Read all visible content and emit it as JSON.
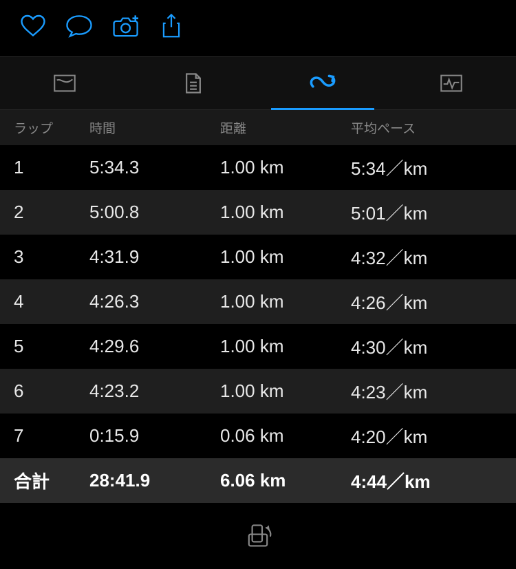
{
  "colors": {
    "accent": "#1a9cff"
  },
  "toolbar": {
    "icons": [
      "heart-icon",
      "comment-icon",
      "camera-plus-icon",
      "share-icon"
    ]
  },
  "tabs": {
    "items": [
      "route-tab",
      "notes-tab",
      "laps-tab",
      "heart-tab"
    ],
    "activeIndex": 2
  },
  "table": {
    "headers": {
      "lap": "ラップ",
      "time": "時間",
      "distance": "距離",
      "pace": "平均ペース"
    },
    "rows": [
      {
        "lap": "1",
        "time": "5:34.3",
        "distance": "1.00 km",
        "pace": "5:34／km"
      },
      {
        "lap": "2",
        "time": "5:00.8",
        "distance": "1.00 km",
        "pace": "5:01／km"
      },
      {
        "lap": "3",
        "time": "4:31.9",
        "distance": "1.00 km",
        "pace": "4:32／km"
      },
      {
        "lap": "4",
        "time": "4:26.3",
        "distance": "1.00 km",
        "pace": "4:26／km"
      },
      {
        "lap": "5",
        "time": "4:29.6",
        "distance": "1.00 km",
        "pace": "4:30／km"
      },
      {
        "lap": "6",
        "time": "4:23.2",
        "distance": "1.00 km",
        "pace": "4:23／km"
      },
      {
        "lap": "7",
        "time": "0:15.9",
        "distance": "0.06 km",
        "pace": "4:20／km"
      }
    ],
    "summary": {
      "lap": "合計",
      "time": "28:41.9",
      "distance": "6.06 km",
      "pace": "4:44／km"
    }
  }
}
